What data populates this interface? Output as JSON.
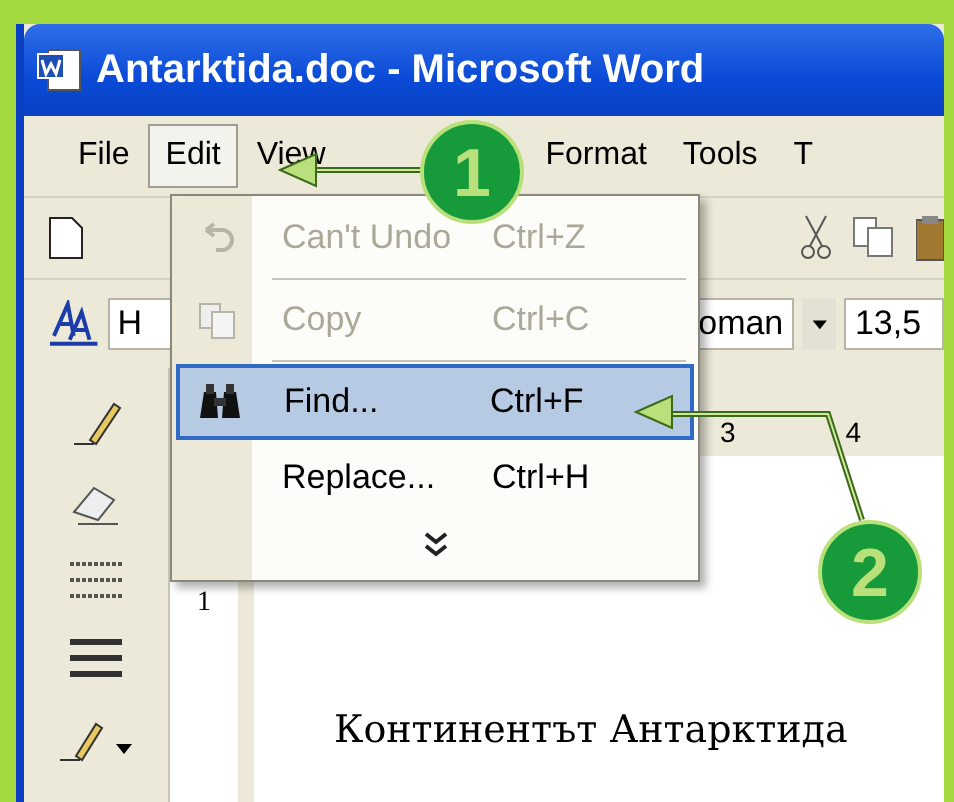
{
  "window": {
    "title": "Antarktida.doc - Microsoft Word"
  },
  "menu_bar": [
    {
      "label": "File",
      "selected": false
    },
    {
      "label": "Edit",
      "selected": true
    },
    {
      "label": "View",
      "selected": false
    },
    {
      "label": "Format",
      "selected": false
    },
    {
      "label": "Tools",
      "selected": false
    },
    {
      "label": "T",
      "selected": false
    }
  ],
  "format_toolbar": {
    "style": "H",
    "font": "oman",
    "size": "13,5"
  },
  "ruler": {
    "horizontal": [
      "3",
      "4"
    ],
    "vertical": [
      "1"
    ]
  },
  "edit_menu": {
    "items": [
      {
        "kind": "command",
        "label": "Can't Undo",
        "shortcut": "Ctrl+Z",
        "disabled": true,
        "selected": false,
        "separator_before": false
      },
      {
        "kind": "command",
        "label": "Copy",
        "shortcut": "Ctrl+C",
        "disabled": true,
        "selected": false,
        "separator_before": true
      },
      {
        "kind": "command",
        "label": "Find...",
        "shortcut": "Ctrl+F",
        "disabled": false,
        "selected": true,
        "separator_before": true
      },
      {
        "kind": "command",
        "label": "Replace...",
        "shortcut": "Ctrl+H",
        "disabled": false,
        "selected": false,
        "separator_before": false
      },
      {
        "kind": "more"
      }
    ]
  },
  "document": {
    "text": "Континентът Антарктида"
  },
  "callouts": [
    {
      "label": "1"
    },
    {
      "label": "2"
    }
  ]
}
